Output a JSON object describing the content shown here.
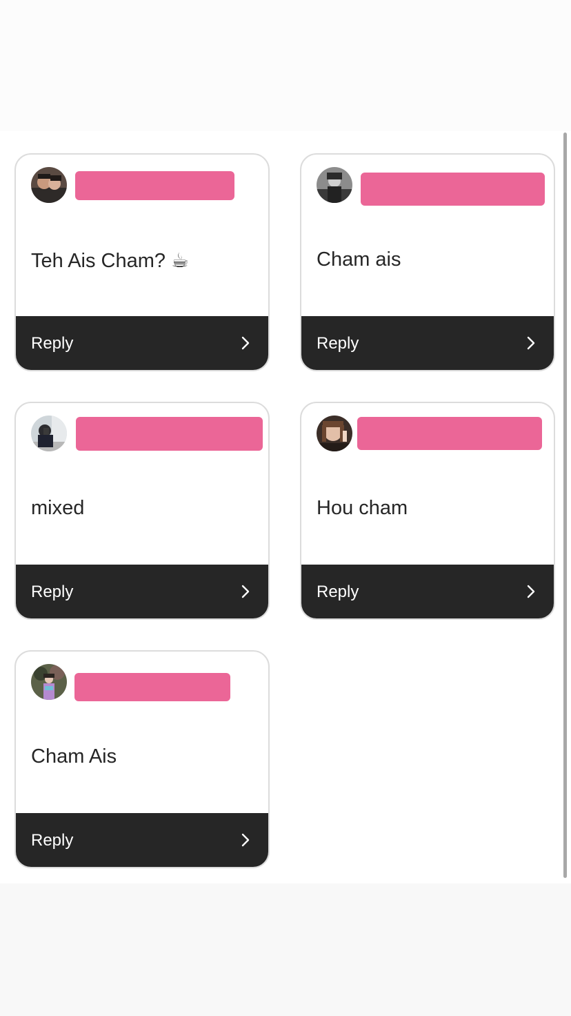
{
  "cards": [
    {
      "message": "Teh Ais Cham? ☕",
      "reply_label": "Reply",
      "avatar": "avatar-photo-couple"
    },
    {
      "message": "Cham ais",
      "reply_label": "Reply",
      "avatar": "avatar-photo-bw"
    },
    {
      "message": "mixed",
      "reply_label": "Reply",
      "avatar": "avatar-photo-mirror-selfie"
    },
    {
      "message": "Hou cham",
      "reply_label": "Reply",
      "avatar": "avatar-photo-peace-sign"
    },
    {
      "message": "Cham Ais",
      "reply_label": "Reply",
      "avatar": "avatar-photo-kimono"
    }
  ],
  "colors": {
    "name_redaction": "#eb6697",
    "reply_bar": "#262626",
    "card_border": "#dcdcdc"
  },
  "icons": {
    "reply_chevron": "chevron-right-icon"
  }
}
